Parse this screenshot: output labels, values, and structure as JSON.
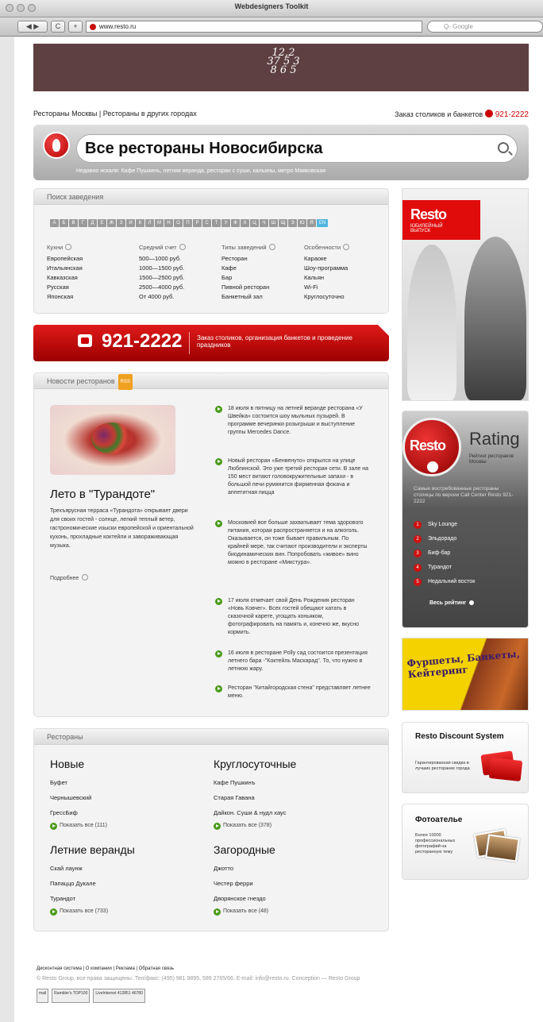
{
  "browser": {
    "window_title": "Webdesigners Toolkit",
    "back": "◀ ▶",
    "reload": "C",
    "add": "+",
    "url": "www.resto.ru",
    "search_placeholder": "Q- Google"
  },
  "banner": {
    "logo_line1": "12,2",
    "logo_line2": "37 5 3",
    "logo_line3": "8 6 5"
  },
  "toplinks": {
    "moscow": "Рестораны Москвы",
    "sep": " | ",
    "other": "Рестораны в других городах"
  },
  "order": {
    "label": "Заказ столиков и банкетов",
    "phone": "921-2222"
  },
  "hero": {
    "title": "Все рестораны",
    "city": " Новосибирска",
    "recent": "Недавно искали: Кафе Пушкинъ, летняя веранда, ресторан с суши, кальяны, метро Маяковская"
  },
  "search_panel": {
    "title": "Поиск заведения",
    "letters": [
      "А",
      "Б",
      "В",
      "Г",
      "Д",
      "Е",
      "Ж",
      "З",
      "И",
      "К",
      "Л",
      "М",
      "Н",
      "О",
      "П",
      "Р",
      "С",
      "Т",
      "У",
      "Ф",
      "Х",
      "Ц",
      "Ч",
      "Ш",
      "Щ",
      "Э",
      "Ю",
      "Я",
      "EN"
    ],
    "columns": [
      {
        "head": "Кухни",
        "items": [
          "Европейская",
          "Итальянская",
          "Кавказская",
          "Русская",
          "Японская"
        ]
      },
      {
        "head": "Средний счет",
        "items": [
          "500—1000 руб.",
          "1000—1500 руб.",
          "1500—2500 руб.",
          "2500—4000 руб.",
          "От 4000 руб."
        ]
      },
      {
        "head": "Типы заведений",
        "items": [
          "Ресторан",
          "Кафе",
          "Бар",
          "Пивной ресторан",
          "Банкетный зал"
        ]
      },
      {
        "head": "Особенности",
        "items": [
          "Караоке",
          "Шоу-программа",
          "Кальян",
          "Wi-Fi",
          "Круглосуточно"
        ]
      }
    ]
  },
  "red_banner": {
    "phone": "921-2222",
    "text": "Заказ столиков, организация банкетов и проведение праздников"
  },
  "news": {
    "title": "Новости ресторанов",
    "badge": "RSS",
    "feature_title": "Лето в \"Турандоте\"",
    "feature_text": "Трехъярусная терраса «Турандота» открывает двери для своих гостей - солнце, легкий теплый ветер, гастрономические изыски европейской и ориентальной кухонь, прохладные коктейли и завораживающая музыка.",
    "more": "Подробнее",
    "items": [
      "18 июля в пятницу на летней веранде ресторана «У Швейка» состоится шоу мыльных пузырей. В программе вечеринки розыгрыши и выступление группы Mercedes Dance.",
      "Новый ресторан «Бенвенуто» открылся на улице Люблинской. Это уже третий ресторан сети. В зале на 150 мест витают головокружительные запахи - в большой печи румянится фирменная фокача и аппетитная пицца",
      "Московией все больше захватывает тема здорового питания, которая распространяется и на алкоголь. Оказывается, он тоже бывает правильным. По крайней мере, так считают производители и эксперты биодинамических вин. Попробовать «живое» вино можно в ресторане «Микстура».",
      "17 июля отмечает свой День Рождения ресторан «Новь Ковчег». Всех гостей обещают катать в сказочной карете, угощать коньяком, фотографировать на память и, конечно же, вкусно кормить.",
      "16 июля в ресторане Polly сад состоится презентация летнего бара -\"Коктейль Маскарад\". То, что нужно в летнюю жару.",
      "Ресторан \"Китайгородская стена\" представляет летнее меню."
    ]
  },
  "restaurants": {
    "title": "Рестораны",
    "groups": [
      {
        "name": "Новые",
        "items": [
          "Буфет",
          "Чернышевский",
          "ГрессБиф"
        ],
        "more": "Показать все (111)"
      },
      {
        "name": "Круглосуточные",
        "items": [
          "Кафе Пушкинъ",
          "Старая Гавана",
          "Дайкон. Суши & нудл хаус"
        ],
        "more": "Показать все (378)"
      },
      {
        "name": "Летние веранды",
        "items": [
          "Скай лаунж",
          "Папаццо Дукале",
          "Турандот"
        ],
        "more": "Показать все (733)"
      },
      {
        "name": "Загородные",
        "items": [
          "Джотто",
          "Честер ферри",
          "Дворянское гнездо"
        ],
        "more": "Показать все (48)"
      }
    ]
  },
  "sidebar": {
    "resto_ad": {
      "brand": "Resto",
      "sub": "ЮБИЛЕЙНЫЙ ВЫПУСК"
    },
    "rating": {
      "brand": "Resto",
      "word": "Rating",
      "sub": "Рейтинг ресторанов Москвы",
      "desc": "Самые востребованные рестораны столицы по версии Call Center Resto 921-2222",
      "items": [
        "Sky Lounge",
        "Эльдорадо",
        "Биф-бар",
        "Турандот",
        "Недальний восток"
      ],
      "all": "Весь рейтинг"
    },
    "catering": {
      "text": "Фуршеты, Банкеты, Кейтеринг"
    },
    "discount": {
      "title": "Resto Discount System",
      "desc": "Гарантированная скидка в лучших ресторанах города"
    },
    "photo": {
      "title": "Фотоателье",
      "desc": "Более 10000 профессиональных фотографий на ресторанную тему"
    }
  },
  "footer": {
    "links": "Дисконтная система | О компании | Реклама | Обратная связь",
    "copyright": "© Resto Group, все права защищены. Тел/факс: (495) 981 9895, 589 2765/66. E-mail: info@resto.ru. Conception — Resto Group",
    "counters": [
      "mail",
      "Rambler's TOP100",
      "LiveInternet 412851 46780"
    ]
  },
  "colors": {
    "accent": "#cc0000",
    "banner": "#5e3f42",
    "green": "#4a9a1a"
  }
}
